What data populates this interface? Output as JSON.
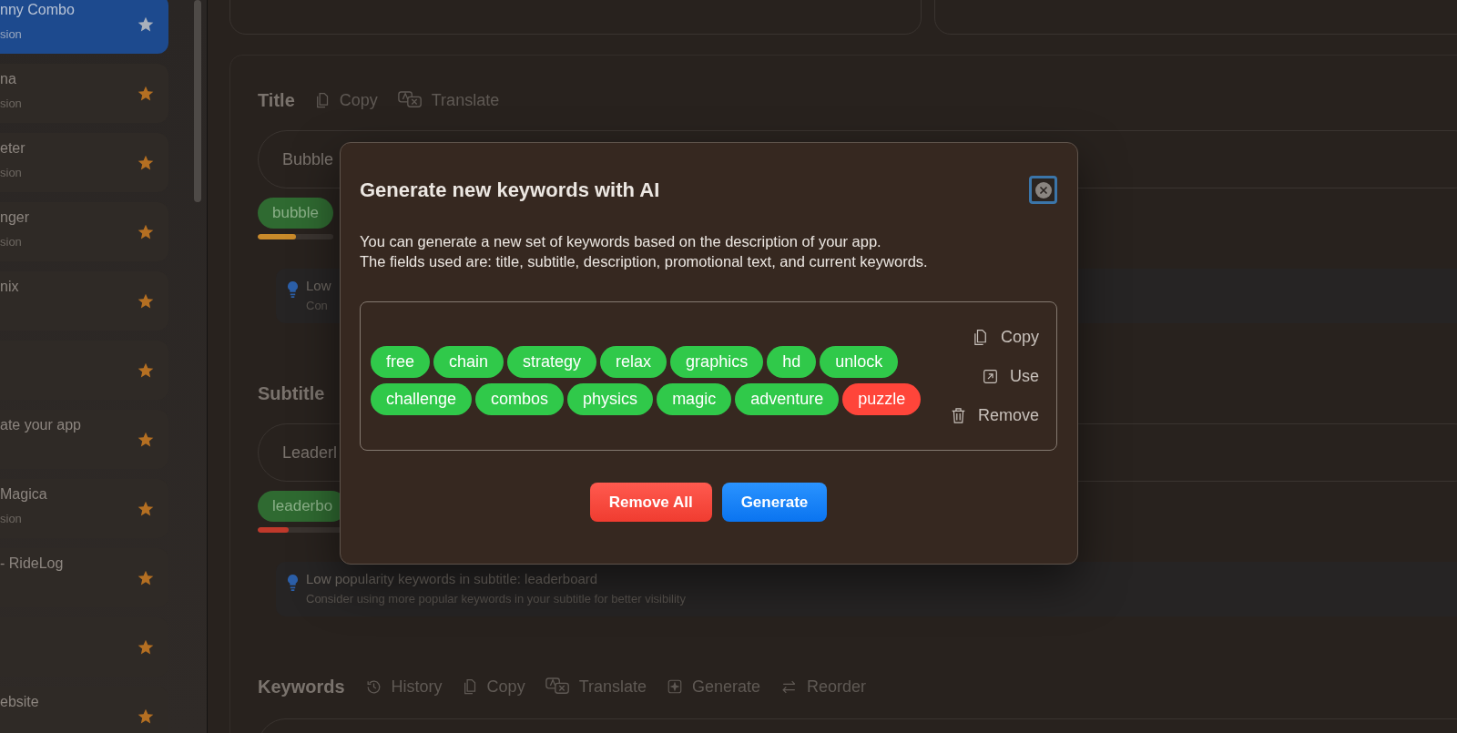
{
  "sidebar": {
    "items": [
      {
        "title": "nny Combo",
        "subtitle": "sion",
        "selected": true
      },
      {
        "title": "na",
        "subtitle": "sion",
        "selected": false
      },
      {
        "title": "eter",
        "subtitle": "sion",
        "selected": false
      },
      {
        "title": "nger",
        "subtitle": "sion",
        "selected": false
      },
      {
        "title": "nix",
        "selected": false
      },
      {
        "selected": false
      },
      {
        "title": "ate your app",
        "selected": false
      },
      {
        "title": "Magica",
        "subtitle": "sion",
        "selected": false
      },
      {
        "title": "- RideLog",
        "selected": false
      },
      {
        "selected": false
      },
      {
        "title": "ebsite",
        "selected": false
      }
    ]
  },
  "sections": [
    {
      "title": "Title",
      "actions": [
        {
          "kind": "copy",
          "label": "Copy"
        },
        {
          "kind": "translate",
          "label": "Translate"
        }
      ],
      "value": "Bubble",
      "chips": [
        {
          "label": "bubble",
          "level": 0.5,
          "color": "#c98a2a"
        }
      ],
      "tip": {
        "title": "Low",
        "text": "Con"
      }
    },
    {
      "title": "Subtitle",
      "value": "Leaderl",
      "chips": [
        {
          "label": "leaderbo",
          "level": 0.35,
          "color": "#c0392b"
        }
      ],
      "tip": {
        "title": "Low popularity keywords in subtitle: leaderboard",
        "text": "Consider using more popular keywords in your subtitle for better visibility"
      }
    },
    {
      "title": "Keywords",
      "actions": [
        {
          "kind": "history",
          "label": "History"
        },
        {
          "kind": "copy",
          "label": "Copy"
        },
        {
          "kind": "translate",
          "label": "Translate"
        },
        {
          "kind": "generate",
          "label": "Generate"
        },
        {
          "kind": "reorder",
          "label": "Reorder"
        }
      ]
    }
  ],
  "dialog": {
    "title": "Generate new keywords with AI",
    "description": [
      "You can generate a new set of keywords based on the description of your app.",
      "The fields used are: title, subtitle, description, promotional text, and current keywords."
    ],
    "keywords": [
      {
        "label": "free",
        "color": "#30c94a"
      },
      {
        "label": "chain",
        "color": "#30c94a"
      },
      {
        "label": "strategy",
        "color": "#30c94a"
      },
      {
        "label": "relax",
        "color": "#30c94a"
      },
      {
        "label": "graphics",
        "color": "#30c94a"
      },
      {
        "label": "hd",
        "color": "#30c94a"
      },
      {
        "label": "unlock",
        "color": "#30c94a"
      },
      {
        "label": "challenge",
        "color": "#30c94a"
      },
      {
        "label": "combos",
        "color": "#30c94a"
      },
      {
        "label": "physics",
        "color": "#30c94a"
      },
      {
        "label": "magic",
        "color": "#30c94a"
      },
      {
        "label": "adventure",
        "color": "#30c94a"
      },
      {
        "label": "puzzle",
        "color": "#ff453a"
      }
    ],
    "actions": [
      {
        "kind": "copy",
        "label": "Copy"
      },
      {
        "kind": "use",
        "label": "Use"
      },
      {
        "kind": "remove",
        "label": "Remove"
      }
    ],
    "buttons": [
      {
        "kind": "destructive",
        "label": "Remove All"
      },
      {
        "kind": "primary",
        "label": "Generate"
      }
    ]
  }
}
